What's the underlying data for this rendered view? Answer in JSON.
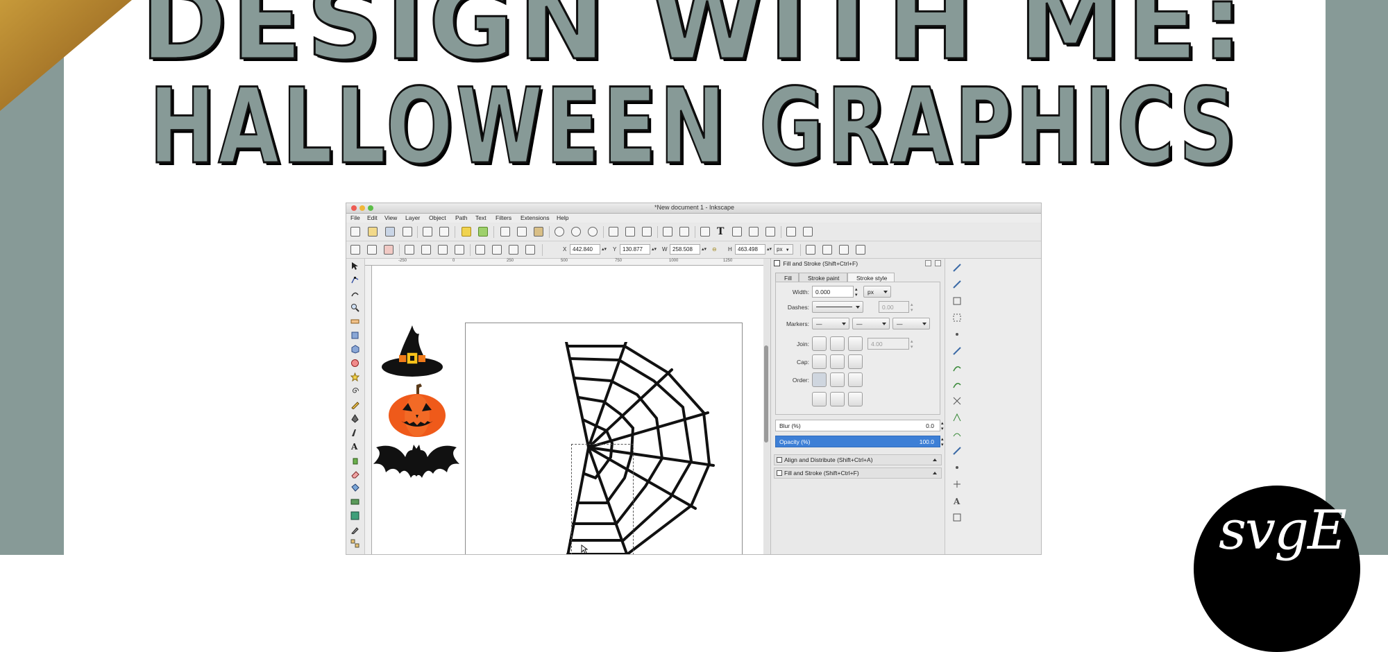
{
  "headline": {
    "line1": "DESIGN WITH ME:",
    "line2": "HALLOWEEN GRAPHICS"
  },
  "logo": {
    "text": "svgE"
  },
  "colors": {
    "sage": "#879a97",
    "gold": "#b8872c",
    "selection": "#3d7fd6",
    "pumpkin": "#ef5a1a"
  },
  "window": {
    "title": "*New document 1 - Inkscape",
    "menu": [
      "File",
      "Edit",
      "View",
      "Layer",
      "Object",
      "Path",
      "Text",
      "Filters",
      "Extensions",
      "Help"
    ]
  },
  "coords": {
    "x_label": "X",
    "x_value": "442.840",
    "y_label": "Y",
    "y_value": "130.877",
    "w_label": "W",
    "w_value": "258.508",
    "h_label": "H",
    "h_value": "463.498",
    "unit": "px"
  },
  "rulers": {
    "top": [
      "-250",
      "0",
      "250",
      "500",
      "750",
      "1000",
      "1250"
    ]
  },
  "panel": {
    "title": "Fill and Stroke (Shift+Ctrl+F)",
    "tabs": [
      "Fill",
      "Stroke paint",
      "Stroke style"
    ],
    "width_label": "Width:",
    "width_value": "0.000",
    "width_unit": "px",
    "dashes_label": "Dashes:",
    "dashes_value": "0.00",
    "markers_label": "Markers:",
    "join_label": "Join:",
    "miter_value": "4.00",
    "cap_label": "Cap:",
    "order_label": "Order:",
    "blur_label": "Blur (%)",
    "blur_value": "0.0",
    "opacity_label": "Opacity (%)",
    "opacity_value": "100.0",
    "dock1": "Align and Distribute (Shift+Ctrl+A)",
    "dock2": "Fill and Stroke (Shift+Ctrl+F)"
  },
  "toolbox_icons": [
    "selector-icon",
    "node-icon",
    "tweak-icon",
    "zoom-icon",
    "measure-icon",
    "rect-icon",
    "box3d-icon",
    "ellipse-icon",
    "star-icon",
    "spiral-icon",
    "pencil-icon",
    "pen-icon",
    "calligraphy-icon",
    "text-icon",
    "spray-icon",
    "eraser-icon",
    "bucket-icon",
    "gradient-icon",
    "mesh-icon",
    "dropper-icon",
    "connector-icon"
  ]
}
